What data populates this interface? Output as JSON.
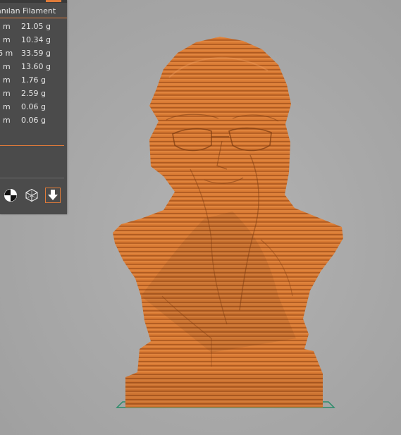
{
  "panel": {
    "header_title": "anılan Filament",
    "rows": [
      {
        "length": "m",
        "weight": "21.05 g"
      },
      {
        "length": "m",
        "weight": "10.34 g"
      },
      {
        "length": "6 m",
        "weight": "33.59 g"
      },
      {
        "length": "m",
        "weight": "13.60 g"
      },
      {
        "length": "m",
        "weight": "1.76 g"
      },
      {
        "length": "m",
        "weight": "2.59 g"
      },
      {
        "length": "m",
        "weight": "0.06 g"
      },
      {
        "length": "m",
        "weight": "0.06 g"
      }
    ],
    "view_buttons": [
      "quadrant-view-icon",
      "wireframe-cube-icon",
      "download-arrow-icon"
    ]
  },
  "colors": {
    "panel_bg": "#4b4b4b",
    "accent": "#e07b39",
    "model_orange": "#d9762f",
    "model_dark": "#9e4a16",
    "build_plate": "#2a8c6a",
    "background": "#a9a9a9"
  },
  "viewport": {
    "object": "bust-model",
    "layer_view": true
  }
}
